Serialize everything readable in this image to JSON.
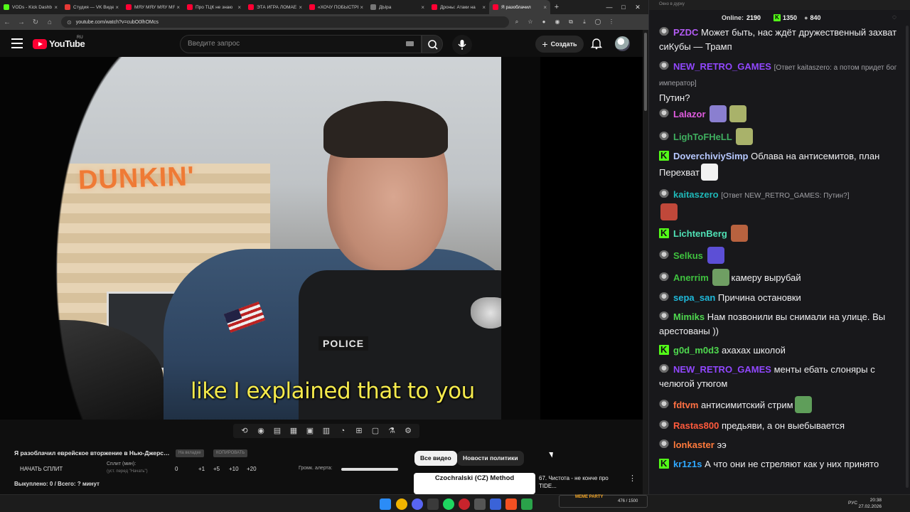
{
  "browser": {
    "tabs": [
      {
        "label": "VODs - Kick Dashb",
        "color": "#53fc18",
        "active": false
      },
      {
        "label": "Студия — VK Видео",
        "color": "#e53935",
        "active": false
      },
      {
        "label": "МЯУ МЯУ МЯУ МЯ",
        "color": "#ff0033",
        "active": false
      },
      {
        "label": "Про ТЦК не знаю",
        "color": "#ff0033",
        "active": false
      },
      {
        "label": "ЭТА ИГРА ЛОМАЕ",
        "color": "#ff0033",
        "active": false
      },
      {
        "label": "«ХОЧУ ПОБЫСТРЕ",
        "color": "#ff0033",
        "active": false
      },
      {
        "label": "ДЫра",
        "color": "#777777",
        "active": false
      },
      {
        "label": "Дроны: Атаки на",
        "color": "#ff0033",
        "active": false
      },
      {
        "label": "Я разоблачил",
        "color": "#ff0033",
        "active": true
      }
    ],
    "url": "youtube.com/watch?v=cubO0lhOMcs"
  },
  "youtube": {
    "logo_text": "YouTube",
    "region": "RU",
    "search_placeholder": "Введите запрос",
    "create_label": "Создать",
    "subtitle": "like I explained that to you",
    "video_text": {
      "sign": "DUNKIN'",
      "police_label": "POLICE"
    }
  },
  "split_panel": {
    "video_title": "Я разоблачил еврейское вторжение в Нью-Джерси...",
    "btn_inactive": "На вкладке",
    "btn_copy": "КОПИРОВАТЬ",
    "start_label": "НАЧАТЬ СПЛИТ",
    "split_min_label": "Сплит (мин):",
    "split_min_note": "(уст. перед \"Начать\")",
    "split_value": "0",
    "steps": [
      "+1",
      "+5",
      "+10",
      "+20"
    ],
    "alert_label": "Громк. алерта:",
    "alert_volume": 1.0,
    "total_line": "Выкуплено: 0 / Всего: ? минут"
  },
  "recommendations": {
    "chips": [
      "Все видео",
      "Новости политики"
    ],
    "active_chip": "Все видео",
    "item": {
      "thumb_title": "Czochralski (CZ) Method",
      "title": "67. Чистота - не конче про TIDE..."
    }
  },
  "chat": {
    "window_title": "Окно в дурку",
    "online_label": "Online:",
    "online_value": "2190",
    "kick_value": "1350",
    "twitch_value": "840",
    "messages": [
      {
        "platform": "twitch",
        "user": "PZDC",
        "color": "#b45cf5",
        "text": "Может быть, нас ждёт дружественный захват сиКубы — Трамп"
      },
      {
        "platform": "twitch",
        "user": "NEW_RETRO_GAMES",
        "color": "#9147ff",
        "reply": "[Ответ kaitaszero: а потом придет бог император]",
        "text": "Путин?"
      },
      {
        "platform": "twitch",
        "user": "Lalazor",
        "color": "#e05ce0",
        "emotes": [
          "#8a7fd0",
          "#a9b26a"
        ]
      },
      {
        "platform": "twitch",
        "user": "LighToFHeLL",
        "color": "#3fae5f",
        "emotes": [
          "#a9b26a"
        ]
      },
      {
        "platform": "kick",
        "user": "DoverchiviySimp",
        "color": "#b7c8ff",
        "text": "Облава на антисемитов, план Перехват",
        "emotes": [
          "#f2f2f2"
        ]
      },
      {
        "platform": "twitch",
        "user": "kaitaszero",
        "color": "#1fb8b8",
        "reply": "[Ответ NEW_RETRO_GAMES: Путин?]",
        "emotes": [
          "#c0483a"
        ]
      },
      {
        "platform": "kick",
        "user": "LichtenBerg",
        "color": "#4fe0b5",
        "emotes": [
          "#b8623f"
        ]
      },
      {
        "platform": "twitch",
        "user": "Selkus",
        "color": "#3fc23f",
        "emotes": [
          "#5c4fd6"
        ]
      },
      {
        "platform": "twitch",
        "user": "Anerrim",
        "color": "#3fc23f",
        "text": "камеру вырубай",
        "emotes": [
          "#6f9e63"
        ]
      },
      {
        "platform": "twitch",
        "user": "sepa_san",
        "color": "#1fb8d9",
        "text": "Причина остановки"
      },
      {
        "platform": "twitch",
        "user": "Mimiks",
        "color": "#4fd84f",
        "text": "Нам позвонили вы снимали на улице. Вы арестованы ))"
      },
      {
        "platform": "kick",
        "user": "g0d_m0d3",
        "color": "#4fd84f",
        "text": "ахахах школой"
      },
      {
        "platform": "twitch",
        "user": "NEW_RETRO_GAMES",
        "color": "#9147ff",
        "text": "менты ебать слоняры с челюгой утюгом"
      },
      {
        "platform": "twitch",
        "user": "fdtvm",
        "color": "#ff7043",
        "text": "антисимитский стрим",
        "emotes": [
          "#5f9e5a"
        ]
      },
      {
        "platform": "twitch",
        "user": "Rastas800",
        "color": "#ff5a3c",
        "text": "предьяви, а он выебывается"
      },
      {
        "platform": "twitch",
        "user": "lonkaster",
        "color": "#ff7a3c",
        "text": "ээ"
      },
      {
        "platform": "kick",
        "user": "kr1z1s",
        "color": "#2fa8ff",
        "text": "А что они не стреляют как у них принято"
      }
    ]
  },
  "taskbar": {
    "widget_label": "MEME PARTY",
    "widget_value": "476 / 1500",
    "lang": "РУС",
    "time": "20:38",
    "date": "27.02.2026"
  }
}
